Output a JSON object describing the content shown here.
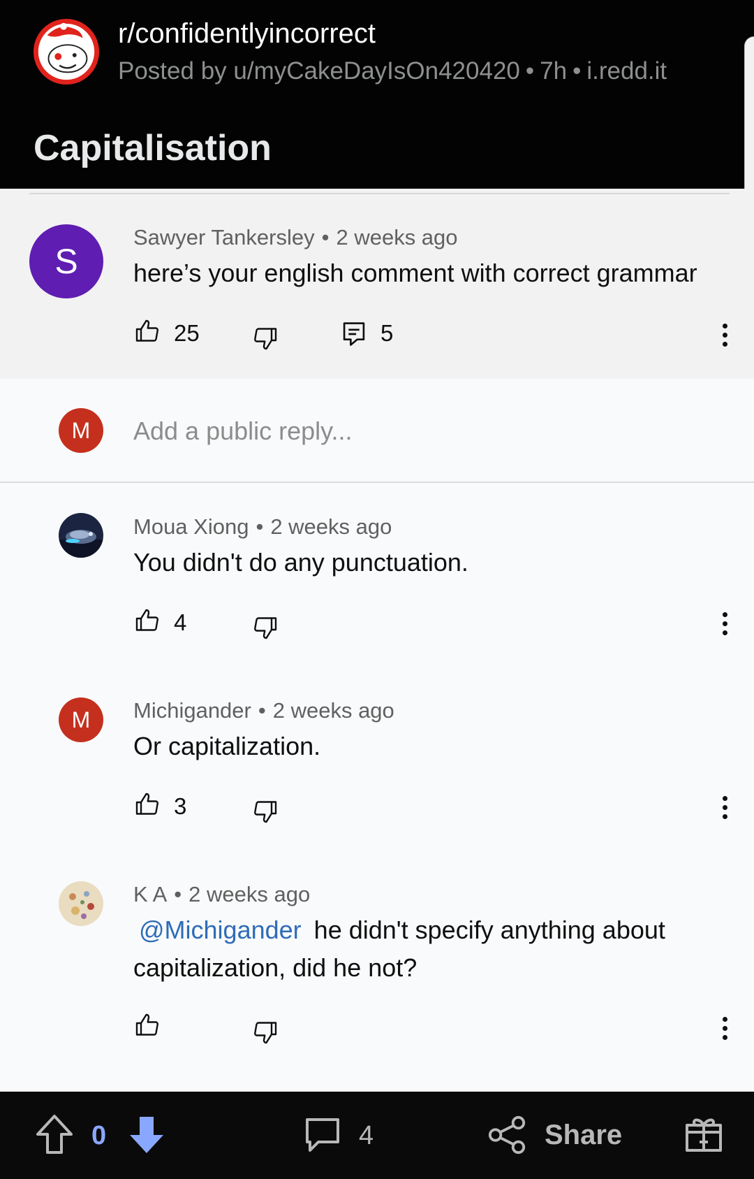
{
  "header": {
    "subreddit": "r/confidentlyincorrect",
    "posted_by": "Posted by u/myCakeDayIsOn420420",
    "age": "7h",
    "domain": "i.redd.it",
    "separator": "•",
    "title": "Capitalisation"
  },
  "main_comment": {
    "avatar_letter": "S",
    "avatar_color": "#5f1db2",
    "author": "Sawyer Tankersley",
    "age": "2 weeks ago",
    "text": "here’s your english comment with correct grammar",
    "likes": "25",
    "replies": "5"
  },
  "reply_box": {
    "avatar_letter": "M",
    "avatar_color": "#c4301d",
    "placeholder": "Add a public reply..."
  },
  "replies": [
    {
      "author": "Moua Xiong",
      "age": "2 weeks ago",
      "text": "You didn't do any punctuation.",
      "likes": "4",
      "avatar": "photo-avatar"
    },
    {
      "author": "Michigander",
      "age": "2 weeks ago",
      "text": "Or capitalization.",
      "likes": "3",
      "avatar_letter": "M",
      "avatar_color": "#c4301d"
    },
    {
      "author": "K A",
      "age": "2 weeks ago",
      "mention": "@Michigander",
      "text": "he didn't specify anything about capitalization, did he not?",
      "likes": "",
      "avatar": "photo-avatar"
    }
  ],
  "bottom_bar": {
    "votes": "0",
    "comments": "4",
    "share_label": "Share",
    "vote_accent": "#8aa7ff"
  }
}
